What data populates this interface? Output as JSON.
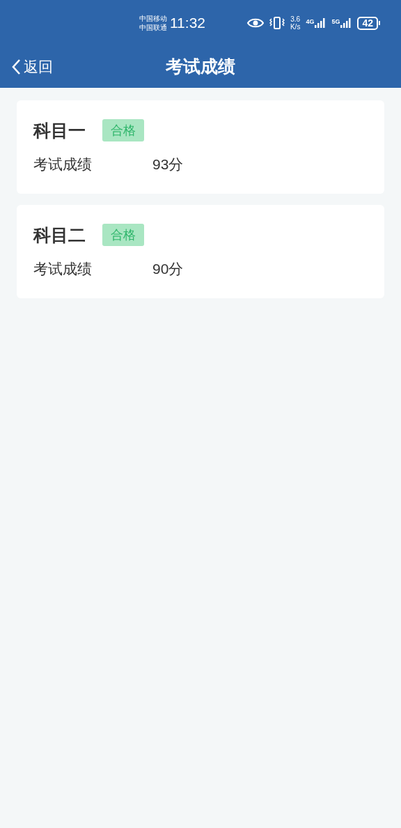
{
  "status_bar": {
    "carriers": [
      "中国移动",
      "中国联通"
    ],
    "time": "11:32",
    "speed_value": "3.6",
    "speed_unit": "K/s",
    "network_1": "4G",
    "network_2": "5G",
    "battery": "42"
  },
  "header": {
    "back": "返回",
    "title": "考试成绩"
  },
  "results": [
    {
      "subject": "科目一",
      "badge": "合格",
      "label": "考试成绩",
      "score": "93分"
    },
    {
      "subject": "科目二",
      "badge": "合格",
      "label": "考试成绩",
      "score": "90分"
    }
  ]
}
